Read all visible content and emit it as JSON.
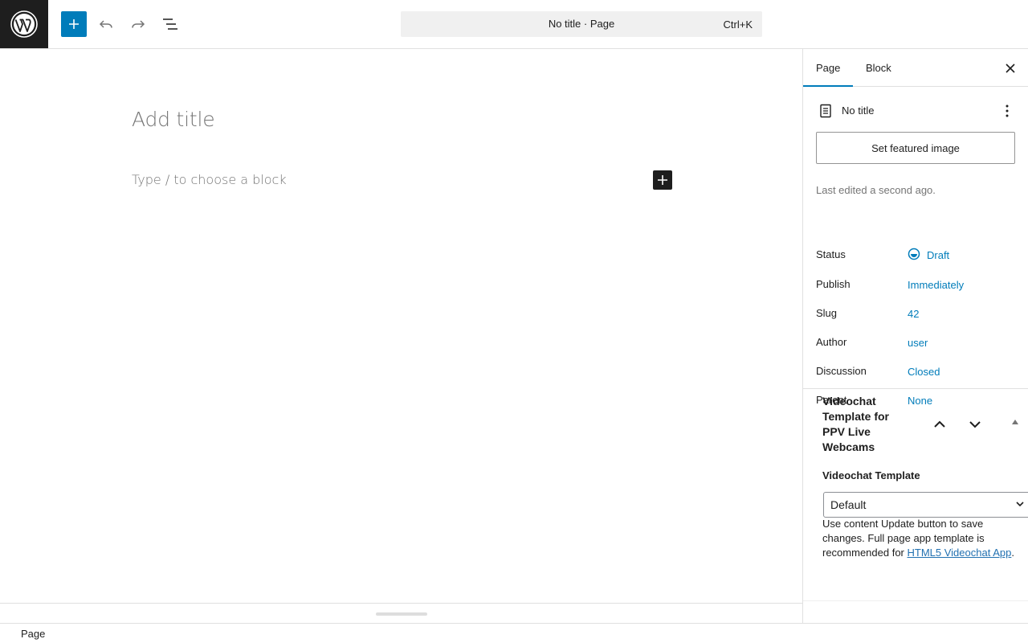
{
  "topbar": {
    "logo_icon": "wordpress-logo-icon",
    "add_icon": "plus-icon",
    "undo_icon": "undo-icon",
    "redo_icon": "redo-icon",
    "list_view_icon": "list-view-icon",
    "command": {
      "title": "No title · Page",
      "shortcut": "Ctrl+K"
    },
    "accent": "#007cba"
  },
  "editor": {
    "title_placeholder": "Add title",
    "block_placeholder": "Type / to choose a block"
  },
  "sidebar": {
    "tabs": [
      {
        "label": "Page"
      },
      {
        "label": "Block"
      }
    ],
    "doc_title": "No title",
    "featured_button": "Set featured image",
    "last_edited": "Last edited a second ago.",
    "rows": [
      {
        "label": "Status",
        "value": "Draft"
      },
      {
        "label": "Publish",
        "value": "Immediately"
      },
      {
        "label": "Slug",
        "value": "42"
      },
      {
        "label": "Author",
        "value": "user"
      },
      {
        "label": "Discussion",
        "value": "Closed"
      },
      {
        "label": "Parent",
        "value": "None"
      }
    ],
    "meta_box": {
      "title": "Videochat Template for PPV Live Webcams",
      "subtitle": "Videochat Template",
      "select_value": "Default",
      "note_text": "Use content Update button to save changes. Full page app template is recommended for ",
      "note_link": "HTML5 Videochat App",
      "note_end": "."
    }
  },
  "footer": {
    "breadcrumb": "Page"
  }
}
